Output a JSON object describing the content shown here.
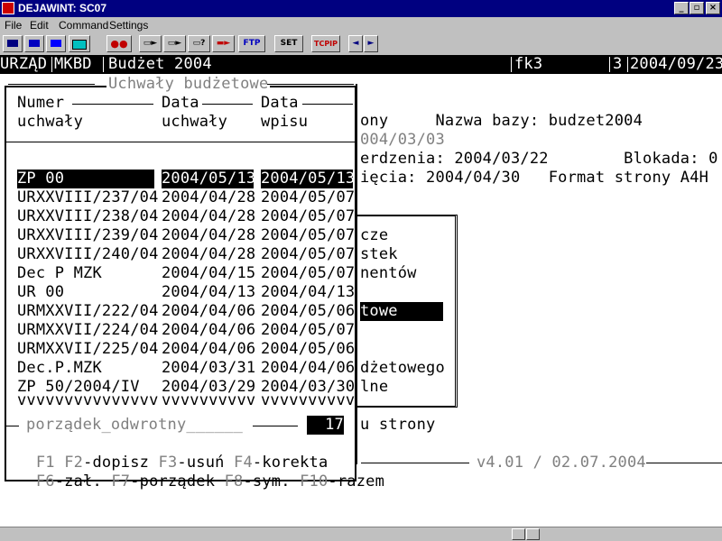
{
  "window": {
    "title": "DEJAWINT:  SC07",
    "minimize_glyph": "_",
    "maximize_glyph": "▫",
    "close_glyph": "×"
  },
  "menu": [
    "File",
    "Edit",
    "Command",
    "Settings"
  ],
  "toolbar": {
    "ftp_label": "FTP",
    "set_label": "SET",
    "tcpip_label": "TCPIP",
    "prev_glyph": "◄",
    "next_glyph": "►"
  },
  "status": {
    "office": "URZĄD",
    "module": "MKBD",
    "name": "Budżet 2004",
    "code": "fk3",
    "num": "3",
    "date": "2004/09/23"
  },
  "background": {
    "line1": "ony     Nazwa bazy: budzet2004",
    "line2": "004/03/03",
    "line3": "erdzenia: 2004/03/22        Blokada: 0",
    "line4": "ięcia: 2004/04/30   Format strony A4H",
    "menu_items": [
      "cze",
      "stek",
      "nentów",
      "",
      "towe",
      "",
      "",
      "dżetowego",
      "lne"
    ],
    "menu_highlight_index": 4,
    "strony": "u strony",
    "version": "v4.01 / 02.07.2004"
  },
  "panel": {
    "title": "Uchwały budżetowe",
    "col1_line1": "Numer",
    "col1_line2": "uchwały",
    "col2_line1": "Data",
    "col2_line2": "uchwały",
    "col3_line1": "Data",
    "col3_line2": "wpisu",
    "rows": [
      {
        "num": "ZP 00",
        "data_uchwaly": "2004/05/13",
        "data_wpisu": "2004/05/13"
      },
      {
        "num": "URXXVIII/237/04",
        "data_uchwaly": "2004/04/28",
        "data_wpisu": "2004/05/07"
      },
      {
        "num": "URXXVIII/238/04",
        "data_uchwaly": "2004/04/28",
        "data_wpisu": "2004/05/07"
      },
      {
        "num": "URXXVIII/239/04",
        "data_uchwaly": "2004/04/28",
        "data_wpisu": "2004/05/07"
      },
      {
        "num": "URXXVIII/240/04",
        "data_uchwaly": "2004/04/28",
        "data_wpisu": "2004/05/07"
      },
      {
        "num": "Dec P MZK",
        "data_uchwaly": "2004/04/15",
        "data_wpisu": "2004/05/07"
      },
      {
        "num": "UR 00",
        "data_uchwaly": "2004/04/13",
        "data_wpisu": "2004/04/13"
      },
      {
        "num": "URMXXVII/222/04",
        "data_uchwaly": "2004/04/06",
        "data_wpisu": "2004/05/06"
      },
      {
        "num": "URMXXVII/224/04",
        "data_uchwaly": "2004/04/06",
        "data_wpisu": "2004/05/07"
      },
      {
        "num": "URMXXVII/225/04",
        "data_uchwaly": "2004/04/06",
        "data_wpisu": "2004/05/06"
      },
      {
        "num": "Dec.P.MZK",
        "data_uchwaly": "2004/03/31",
        "data_wpisu": "2004/04/06"
      },
      {
        "num": "ZP 50/2004/IV",
        "data_uchwaly": "2004/03/29",
        "data_wpisu": "2004/03/30"
      }
    ],
    "more_marks_1": "vvvvvvvvvvvvvvv",
    "more_marks_2": "vvvvvvvvvv",
    "more_marks_3": "vvvvvvvvvv",
    "sort_label": "porządek_odwrotny______",
    "count": "17",
    "keys_line1": [
      {
        "key": "F1",
        "label": ""
      },
      {
        "key": "F2",
        "label": "-dopisz"
      },
      {
        "key": "F3",
        "label": "-usuń"
      },
      {
        "key": "F4",
        "label": "-korekta"
      }
    ],
    "keys_line2": [
      {
        "key": "F6",
        "label": "-zał."
      },
      {
        "key": "F7",
        "label": "-porządek"
      },
      {
        "key": "F8",
        "label": "-sym."
      },
      {
        "key": "F10",
        "label": "-razem"
      }
    ]
  },
  "colors": {
    "titlebar": "#000080",
    "chrome": "#c0c0c0",
    "screen_bg": "#ffffff",
    "text": "#000000",
    "dim_text": "#808080"
  }
}
